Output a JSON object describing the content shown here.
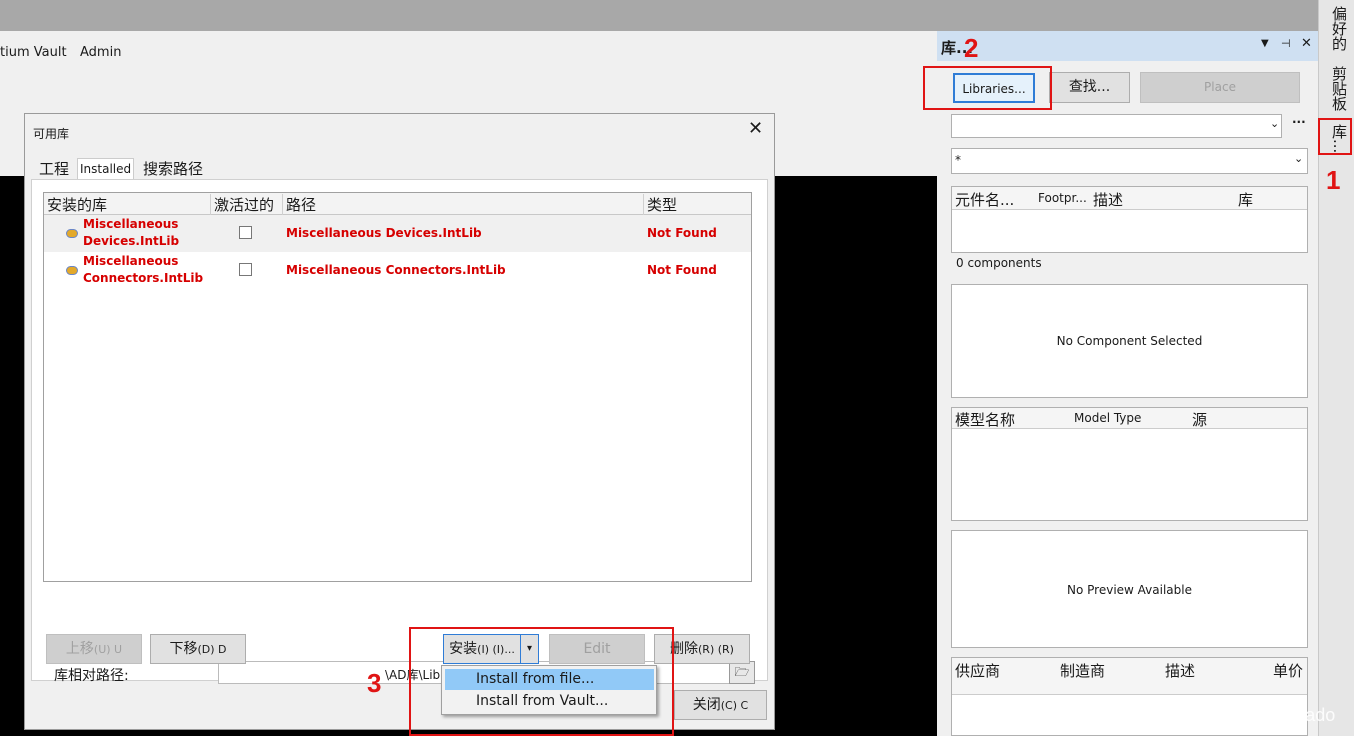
{
  "menubar": {
    "items": [
      "tium Vault",
      "Admin"
    ]
  },
  "dialog": {
    "title": "可用库",
    "tabs": [
      "工程",
      "Installed",
      "搜索路径"
    ],
    "columns": [
      "安装的库",
      "激活过的",
      "路径",
      "类型"
    ],
    "rows": [
      {
        "name_line1": "Miscellaneous",
        "name_line2": "Devices.IntLib",
        "activated": false,
        "path": "Miscellaneous Devices.IntLib",
        "type": "Not Found"
      },
      {
        "name_line1": "Miscellaneous",
        "name_line2": "Connectors.IntLib",
        "activated": false,
        "path": "Miscellaneous Connectors.IntLib",
        "type": "Not Found"
      }
    ],
    "path_label": "库相对路径:",
    "path_value": "\\AD库\\Library",
    "buttons": {
      "up": "上移",
      "up_shortcut": "(U) U",
      "down": "下移",
      "down_shortcut": "(D) D",
      "install": "安装",
      "install_shortcut": "(I) (I)...",
      "edit": "Edit",
      "remove": "删除",
      "remove_shortcut": "(R) (R)",
      "close": "关闭",
      "close_shortcut": "(C) C"
    },
    "install_menu": [
      "Install from file...",
      "Install from Vault..."
    ]
  },
  "panel": {
    "title": "库...",
    "libraries_button": "Libraries...",
    "search_button": "查找...",
    "place_button": "Place",
    "more_glyph": "···",
    "filter_value": "*",
    "component_columns": [
      "元件名...",
      "Footpr...",
      "描述",
      "库"
    ],
    "component_count": "0 components",
    "no_component": "No Component Selected",
    "model_columns": [
      "模型名称",
      "Model Type",
      "源"
    ],
    "no_preview": "No Preview Available",
    "supplier_columns": [
      "供应商",
      "制造商",
      "描述",
      "单价"
    ]
  },
  "side_tabs": [
    "偏好的",
    "剪贴板",
    "库..."
  ],
  "annotations": [
    "1",
    "2",
    "3"
  ],
  "watermark": "CSDN @JamesRicado",
  "colors": {
    "highlight_red": "#e01414",
    "not_found_red": "#d60000",
    "menu_highlight": "#91c9f7",
    "panel_title": "#cfe0f2"
  }
}
